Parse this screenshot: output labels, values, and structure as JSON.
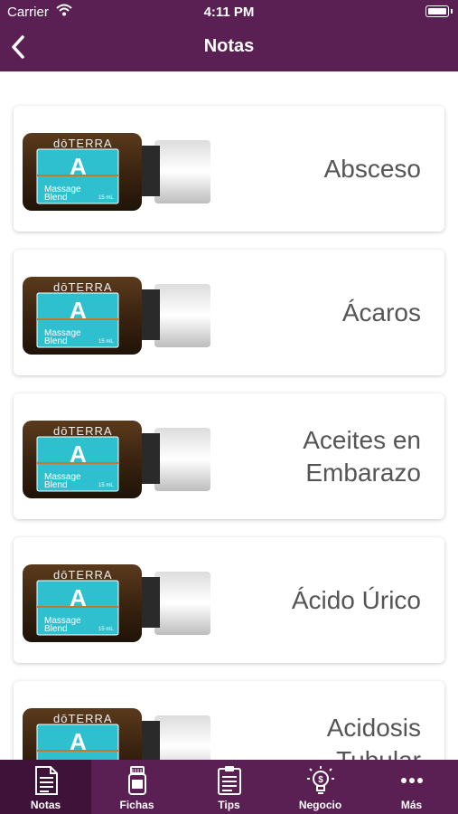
{
  "status_bar": {
    "carrier": "Carrier",
    "time": "4:11 PM"
  },
  "nav": {
    "title": "Notas",
    "back_icon": "chevron-left-icon"
  },
  "product": {
    "brand": "dōTERRA",
    "letter": "A",
    "name_line1": "Massage",
    "name_line2": "Blend",
    "size": "15 mL"
  },
  "items": [
    {
      "title_line1": "Absceso",
      "title_line2": ""
    },
    {
      "title_line1": "Ácaros",
      "title_line2": ""
    },
    {
      "title_line1": "Aceites en",
      "title_line2": "Embarazo"
    },
    {
      "title_line1": "Ácido Úrico",
      "title_line2": ""
    },
    {
      "title_line1": "Acidosis",
      "title_line2": "Tubular"
    }
  ],
  "tabs": [
    {
      "label": "Notas",
      "icon": "document-icon",
      "active": true
    },
    {
      "label": "Fichas",
      "icon": "bottle-icon",
      "active": false
    },
    {
      "label": "Tips",
      "icon": "clipboard-icon",
      "active": false
    },
    {
      "label": "Negocio",
      "icon": "lightbulb-icon",
      "active": false
    },
    {
      "label": "Más",
      "icon": "more-icon",
      "active": false
    }
  ],
  "colors": {
    "brand": "#5a2053",
    "tab_active": "#3f1239",
    "label_teal": "#2ec0cf"
  }
}
